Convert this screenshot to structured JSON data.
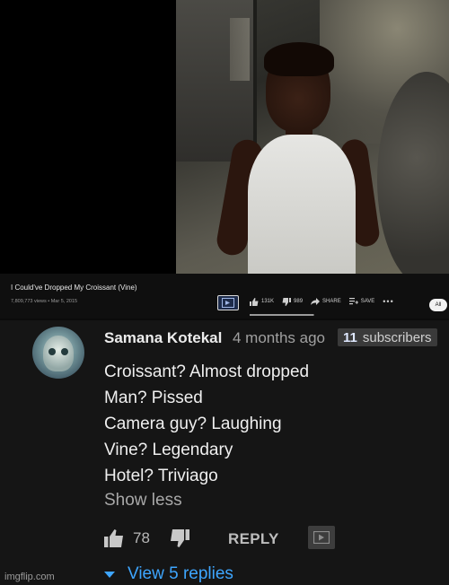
{
  "video": {
    "title": "I Could've Dropped My Croissant (Vine)",
    "meta": "7,809,773 views • Mar 5, 2015",
    "likes": "131K",
    "dislikes": "989",
    "share_label": "SHARE",
    "save_label": "SAVE",
    "more_label": "•••",
    "like_ratio": 0.99
  },
  "filter_chip": "All",
  "comment": {
    "author": "Samana Kotekal",
    "time": "4 months ago",
    "subscribers_count": "11",
    "subscribers_label": "subscribers",
    "lines": [
      "Croissant? Almost dropped",
      "Man? Pissed",
      "Camera guy? Laughing",
      "Vine? Legendary",
      "Hotel? Triviago"
    ],
    "show_less": "Show less",
    "likes": "78",
    "reply_label": "REPLY",
    "view_replies": "View 5 replies"
  },
  "watermark": "imgflip.com",
  "colors": {
    "link_blue": "#3ea6ff",
    "background": "#151515"
  }
}
